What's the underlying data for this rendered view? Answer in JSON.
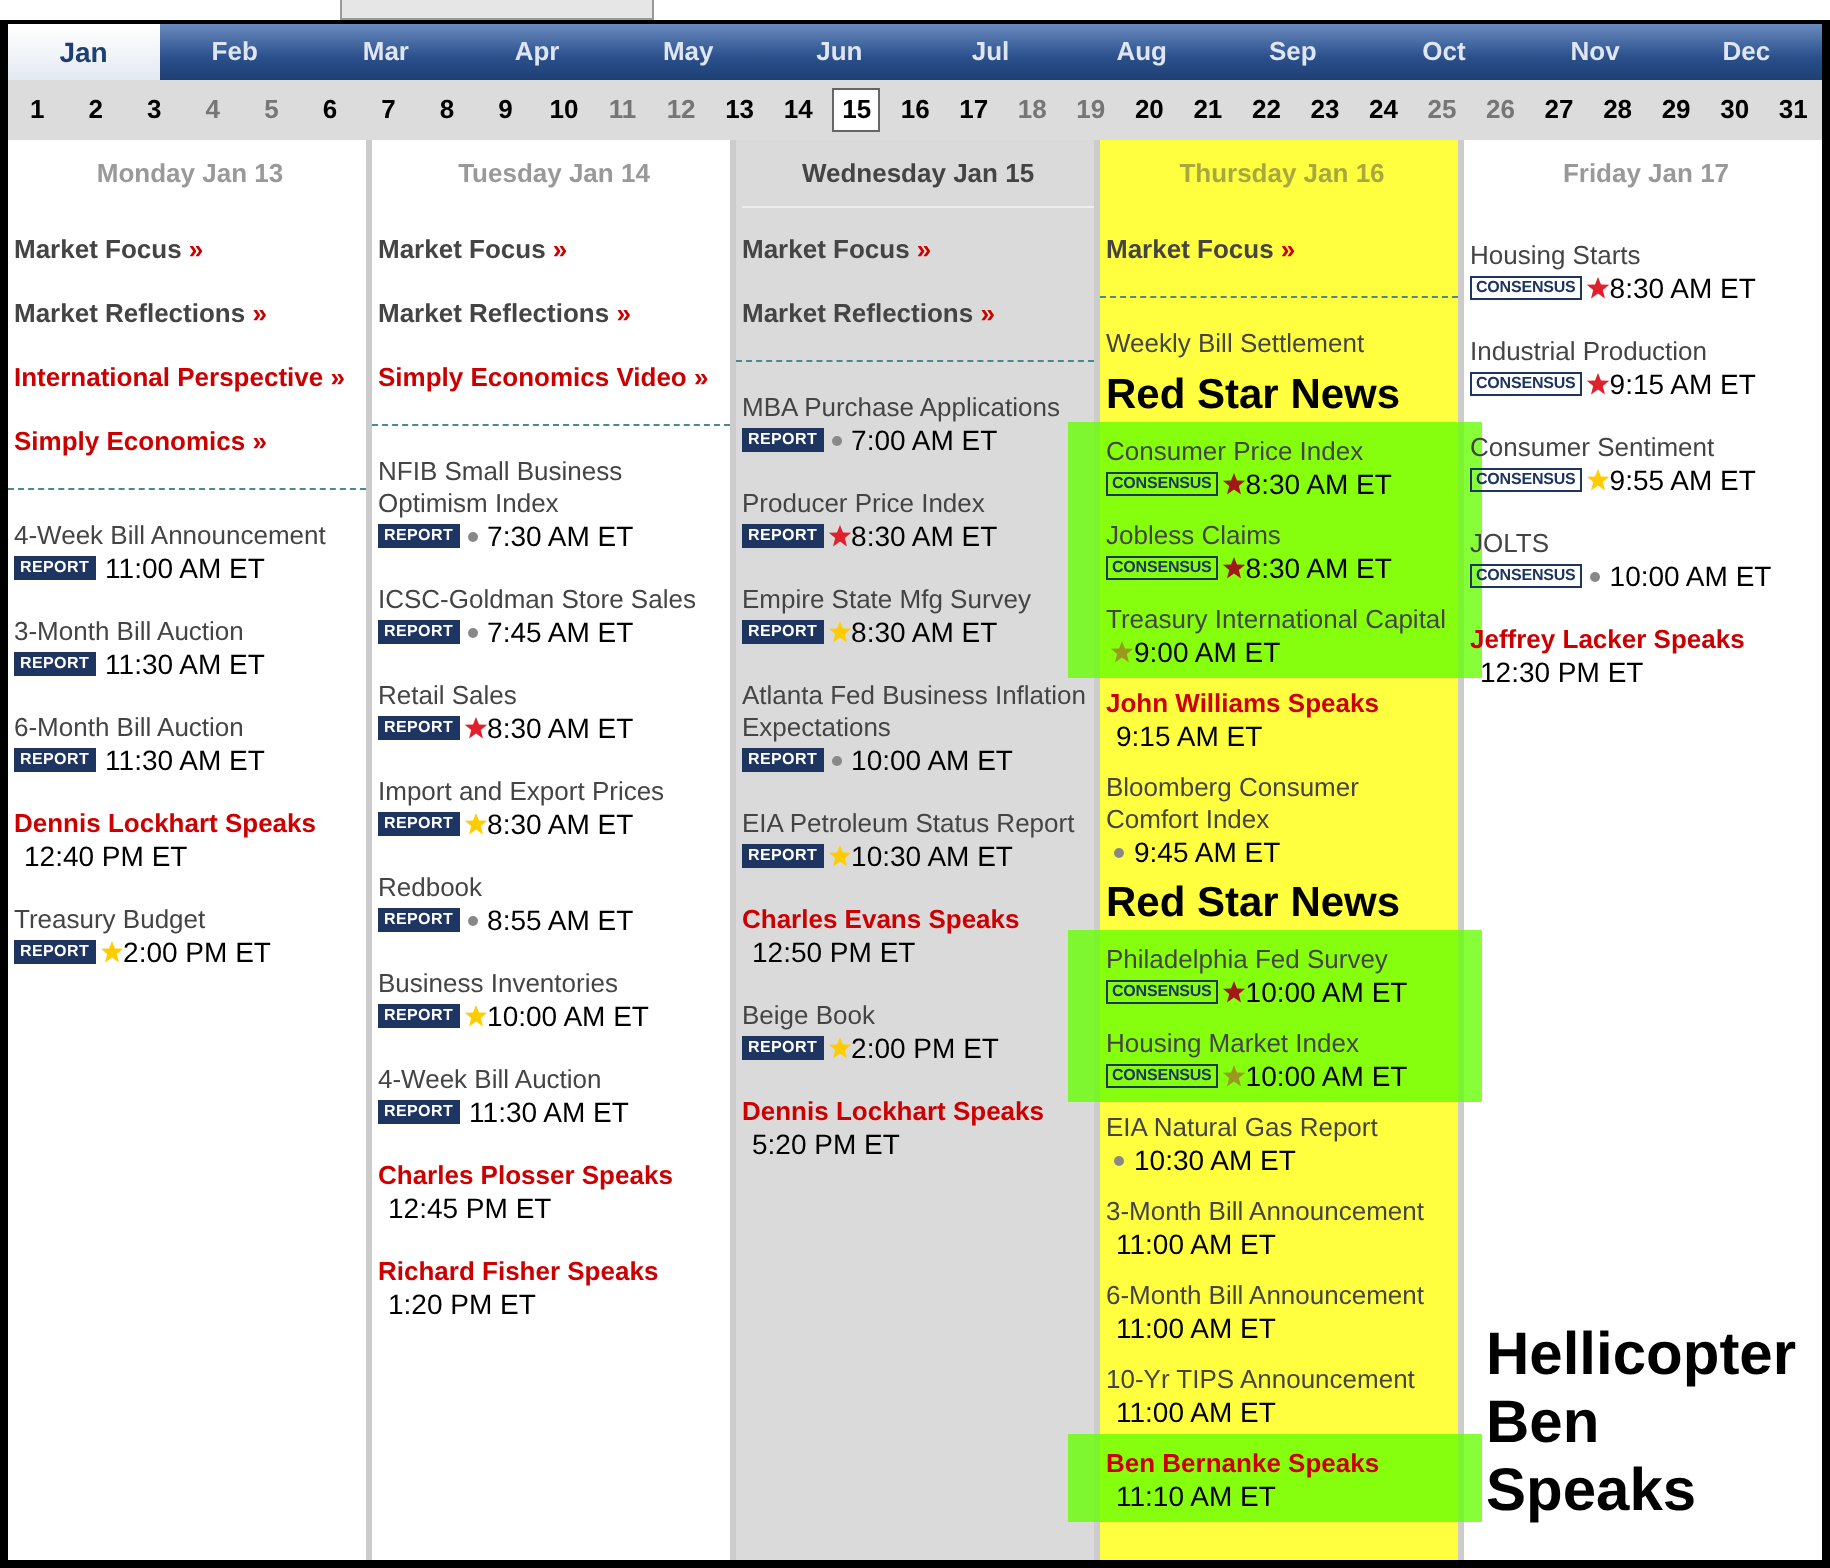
{
  "months": [
    {
      "label": "Jan",
      "selected": true
    },
    {
      "label": "Feb",
      "selected": false
    },
    {
      "label": "Mar",
      "selected": false
    },
    {
      "label": "Apr",
      "selected": false
    },
    {
      "label": "May",
      "selected": false
    },
    {
      "label": "Jun",
      "selected": false
    },
    {
      "label": "Jul",
      "selected": false
    },
    {
      "label": "Aug",
      "selected": false
    },
    {
      "label": "Sep",
      "selected": false
    },
    {
      "label": "Oct",
      "selected": false
    },
    {
      "label": "Nov",
      "selected": false
    },
    {
      "label": "Dec",
      "selected": false
    }
  ],
  "dates": [
    {
      "label": "1",
      "weekend": false,
      "selected": false
    },
    {
      "label": "2",
      "weekend": false,
      "selected": false
    },
    {
      "label": "3",
      "weekend": false,
      "selected": false
    },
    {
      "label": "4",
      "weekend": true,
      "selected": false
    },
    {
      "label": "5",
      "weekend": true,
      "selected": false
    },
    {
      "label": "6",
      "weekend": false,
      "selected": false
    },
    {
      "label": "7",
      "weekend": false,
      "selected": false
    },
    {
      "label": "8",
      "weekend": false,
      "selected": false
    },
    {
      "label": "9",
      "weekend": false,
      "selected": false
    },
    {
      "label": "10",
      "weekend": false,
      "selected": false
    },
    {
      "label": "11",
      "weekend": true,
      "selected": false
    },
    {
      "label": "12",
      "weekend": true,
      "selected": false
    },
    {
      "label": "13",
      "weekend": false,
      "selected": false
    },
    {
      "label": "14",
      "weekend": false,
      "selected": false
    },
    {
      "label": "15",
      "weekend": false,
      "selected": true
    },
    {
      "label": "16",
      "weekend": false,
      "selected": false
    },
    {
      "label": "17",
      "weekend": false,
      "selected": false
    },
    {
      "label": "18",
      "weekend": true,
      "selected": false
    },
    {
      "label": "19",
      "weekend": true,
      "selected": false
    },
    {
      "label": "20",
      "weekend": false,
      "selected": false
    },
    {
      "label": "21",
      "weekend": false,
      "selected": false
    },
    {
      "label": "22",
      "weekend": false,
      "selected": false
    },
    {
      "label": "23",
      "weekend": false,
      "selected": false
    },
    {
      "label": "24",
      "weekend": false,
      "selected": false
    },
    {
      "label": "25",
      "weekend": true,
      "selected": false
    },
    {
      "label": "26",
      "weekend": true,
      "selected": false
    },
    {
      "label": "27",
      "weekend": false,
      "selected": false
    },
    {
      "label": "28",
      "weekend": false,
      "selected": false
    },
    {
      "label": "29",
      "weekend": false,
      "selected": false
    },
    {
      "label": "30",
      "weekend": false,
      "selected": false
    },
    {
      "label": "31",
      "weekend": false,
      "selected": false
    }
  ],
  "days": [
    {
      "label": "Monday Jan 13",
      "selected": false,
      "highlight": false,
      "links": [
        {
          "kind": "standard",
          "label": "Market Focus",
          "arrow": "»"
        },
        {
          "kind": "standard",
          "label": "Market Reflections",
          "arrow": "»"
        },
        {
          "kind": "featured",
          "label": "International Perspective",
          "arrow": "»"
        },
        {
          "kind": "featured",
          "label": "Simply Economics",
          "arrow": "»"
        }
      ],
      "events": [
        {
          "kind": "release",
          "title": "4-Week Bill Announcement",
          "badge": {
            "kind": "report",
            "label": "REPORT"
          },
          "time": "11:00 AM ET",
          "highlight": false
        },
        {
          "kind": "release",
          "title": "3-Month Bill Auction",
          "badge": {
            "kind": "report",
            "label": "REPORT"
          },
          "time": "11:30 AM ET",
          "highlight": false
        },
        {
          "kind": "release",
          "title": "6-Month Bill Auction",
          "badge": {
            "kind": "report",
            "label": "REPORT"
          },
          "time": "11:30 AM ET",
          "highlight": false
        },
        {
          "kind": "speaker",
          "title": "Dennis Lockhart Speaks",
          "time": "12:40 PM ET",
          "highlight": false
        },
        {
          "kind": "release",
          "title": "Treasury Budget",
          "badge": {
            "kind": "report",
            "label": "REPORT"
          },
          "marker": {
            "kind": "star",
            "color": "#ffcc00"
          },
          "time": "2:00 PM ET",
          "highlight": false
        }
      ]
    },
    {
      "label": "Tuesday Jan 14",
      "selected": false,
      "highlight": false,
      "links": [
        {
          "kind": "standard",
          "label": "Market Focus",
          "arrow": "»"
        },
        {
          "kind": "standard",
          "label": "Market Reflections",
          "arrow": "»"
        },
        {
          "kind": "featured",
          "label": "Simply Economics Video",
          "arrow": "»"
        }
      ],
      "events": [
        {
          "kind": "release",
          "title": "NFIB Small Business Optimism Index",
          "badge": {
            "kind": "report",
            "label": "REPORT"
          },
          "marker": {
            "kind": "dot",
            "color": "#888888"
          },
          "time": "7:30 AM ET",
          "highlight": false
        },
        {
          "kind": "release",
          "title": "ICSC-Goldman Store Sales",
          "badge": {
            "kind": "report",
            "label": "REPORT"
          },
          "marker": {
            "kind": "dot",
            "color": "#888888"
          },
          "time": "7:45 AM ET",
          "highlight": false
        },
        {
          "kind": "release",
          "title": "Retail Sales",
          "badge": {
            "kind": "report",
            "label": "REPORT"
          },
          "marker": {
            "kind": "star",
            "color": "#e0202a"
          },
          "time": "8:30 AM ET",
          "highlight": false
        },
        {
          "kind": "release",
          "title": "Import and Export Prices",
          "badge": {
            "kind": "report",
            "label": "REPORT"
          },
          "marker": {
            "kind": "star",
            "color": "#ffcc00"
          },
          "time": "8:30 AM ET",
          "highlight": false
        },
        {
          "kind": "release",
          "title": "Redbook",
          "badge": {
            "kind": "report",
            "label": "REPORT"
          },
          "marker": {
            "kind": "dot",
            "color": "#888888"
          },
          "time": "8:55 AM ET",
          "highlight": false
        },
        {
          "kind": "release",
          "title": "Business Inventories",
          "badge": {
            "kind": "report",
            "label": "REPORT"
          },
          "marker": {
            "kind": "star",
            "color": "#ffcc00"
          },
          "time": "10:00 AM ET",
          "highlight": false
        },
        {
          "kind": "release",
          "title": "4-Week Bill Auction",
          "badge": {
            "kind": "report",
            "label": "REPORT"
          },
          "time": "11:30 AM ET",
          "highlight": false
        },
        {
          "kind": "speaker",
          "title": "Charles Plosser Speaks",
          "time": "12:45 PM ET",
          "highlight": false
        },
        {
          "kind": "speaker",
          "title": "Richard Fisher Speaks",
          "time": "1:20 PM ET",
          "highlight": false
        }
      ]
    },
    {
      "label": "Wednesday Jan 15",
      "selected": true,
      "highlight": false,
      "links": [
        {
          "kind": "standard",
          "label": "Market Focus",
          "arrow": "»"
        },
        {
          "kind": "standard",
          "label": "Market Reflections",
          "arrow": "»"
        }
      ],
      "events": [
        {
          "kind": "release",
          "title": "MBA Purchase Applications",
          "badge": {
            "kind": "report",
            "label": "REPORT"
          },
          "marker": {
            "kind": "dot",
            "color": "#888888"
          },
          "time": "7:00 AM ET",
          "highlight": false
        },
        {
          "kind": "release",
          "title": "Producer Price Index",
          "badge": {
            "kind": "report",
            "label": "REPORT"
          },
          "marker": {
            "kind": "star",
            "color": "#e0202a"
          },
          "time": "8:30 AM ET",
          "highlight": false
        },
        {
          "kind": "release",
          "title": "Empire State Mfg Survey",
          "badge": {
            "kind": "report",
            "label": "REPORT"
          },
          "marker": {
            "kind": "star",
            "color": "#ffcc00"
          },
          "time": "8:30 AM ET",
          "highlight": false
        },
        {
          "kind": "release",
          "title": "Atlanta Fed Business Inflation Expectations",
          "badge": {
            "kind": "report",
            "label": "REPORT"
          },
          "marker": {
            "kind": "dot",
            "color": "#888888"
          },
          "time": "10:00 AM ET",
          "highlight": false
        },
        {
          "kind": "release",
          "title": "EIA Petroleum Status Report",
          "badge": {
            "kind": "report",
            "label": "REPORT"
          },
          "marker": {
            "kind": "star",
            "color": "#ffcc00"
          },
          "time": "10:30 AM ET",
          "highlight": false
        },
        {
          "kind": "speaker",
          "title": "Charles Evans Speaks",
          "time": "12:50 PM ET",
          "highlight": false
        },
        {
          "kind": "release",
          "title": "Beige Book",
          "badge": {
            "kind": "report",
            "label": "REPORT"
          },
          "marker": {
            "kind": "star",
            "color": "#ffcc00"
          },
          "time": "2:00 PM ET",
          "highlight": false
        },
        {
          "kind": "speaker",
          "title": "Dennis Lockhart Speaks",
          "time": "5:20 PM ET",
          "highlight": false
        }
      ]
    },
    {
      "label": "Thursday Jan 16",
      "selected": false,
      "highlight": true,
      "links": [
        {
          "kind": "standard",
          "label": "Market Focus",
          "arrow": "»"
        }
      ],
      "events": [
        {
          "kind": "release",
          "title": "Weekly Bill Settlement",
          "highlight": false
        },
        {
          "kind": "release",
          "title": "Consumer Price Index",
          "badge": {
            "kind": "consensus",
            "label": "CONSENSUS"
          },
          "marker": {
            "kind": "star",
            "color": "#a01818"
          },
          "time": "8:30 AM ET",
          "highlight": true,
          "callout": {
            "text": "Red Star News",
            "kind": "above"
          }
        },
        {
          "kind": "release",
          "title": "Jobless Claims",
          "badge": {
            "kind": "consensus",
            "label": "CONSENSUS"
          },
          "marker": {
            "kind": "star",
            "color": "#a01818"
          },
          "time": "8:30 AM ET",
          "highlight": true
        },
        {
          "kind": "release",
          "title": "Treasury International Capital",
          "marker": {
            "kind": "star",
            "color": "#9a9a20"
          },
          "time": "9:00 AM ET",
          "highlight": true
        },
        {
          "kind": "speaker",
          "title": "John Williams Speaks",
          "time": "9:15 AM ET",
          "highlight": false
        },
        {
          "kind": "release",
          "title": "Bloomberg Consumer Comfort Index",
          "marker": {
            "kind": "dot",
            "color": "#888888"
          },
          "time": "9:45 AM ET",
          "highlight": false
        },
        {
          "kind": "release",
          "title": "Philadelphia Fed Survey",
          "badge": {
            "kind": "consensus",
            "label": "CONSENSUS"
          },
          "marker": {
            "kind": "star",
            "color": "#a01818"
          },
          "time": "10:00 AM ET",
          "highlight": true,
          "callout": {
            "text": "Red Star News",
            "kind": "above"
          }
        },
        {
          "kind": "release",
          "title": "Housing Market Index",
          "badge": {
            "kind": "consensus",
            "label": "CONSENSUS"
          },
          "marker": {
            "kind": "star",
            "color": "#9a9a20"
          },
          "time": "10:00 AM ET",
          "highlight": true
        },
        {
          "kind": "release",
          "title": "EIA Natural Gas Report",
          "marker": {
            "kind": "dot",
            "color": "#888888"
          },
          "time": "10:30 AM ET",
          "highlight": false
        },
        {
          "kind": "release",
          "title": "3-Month Bill Announcement",
          "time": "11:00 AM ET",
          "highlight": false
        },
        {
          "kind": "release",
          "title": "6-Month Bill Announcement",
          "time": "11:00 AM ET",
          "highlight": false
        },
        {
          "kind": "release",
          "title": "10-Yr TIPS Announcement",
          "time": "11:00 AM ET",
          "highlight": false
        },
        {
          "kind": "speaker",
          "title": "Ben Bernanke Speaks",
          "time": "11:10 AM ET",
          "highlight": true,
          "callout": {
            "text": "Hellicopter Ben Speaks",
            "kind": "right"
          }
        }
      ]
    },
    {
      "label": "Friday Jan 17",
      "selected": false,
      "highlight": false,
      "events": [
        {
          "kind": "release",
          "title": "Housing Starts",
          "badge": {
            "kind": "consensus",
            "label": "CONSENSUS"
          },
          "marker": {
            "kind": "star",
            "color": "#e0202a"
          },
          "time": "8:30 AM ET",
          "highlight": false
        },
        {
          "kind": "release",
          "title": "Industrial Production",
          "badge": {
            "kind": "consensus",
            "label": "CONSENSUS"
          },
          "marker": {
            "kind": "star",
            "color": "#e0202a"
          },
          "time": "9:15 AM ET",
          "highlight": false
        },
        {
          "kind": "release",
          "title": "Consumer Sentiment",
          "badge": {
            "kind": "consensus",
            "label": "CONSENSUS"
          },
          "marker": {
            "kind": "star",
            "color": "#ffcc00"
          },
          "time": "9:55 AM ET",
          "highlight": false
        },
        {
          "kind": "release",
          "title": "JOLTS",
          "badge": {
            "kind": "consensus",
            "label": "CONSENSUS"
          },
          "marker": {
            "kind": "dot",
            "color": "#888888"
          },
          "time": "10:00 AM ET",
          "highlight": false
        },
        {
          "kind": "speaker",
          "title": "Jeffrey Lacker Speaks",
          "time": "12:30 PM ET",
          "highlight": false
        }
      ]
    }
  ]
}
